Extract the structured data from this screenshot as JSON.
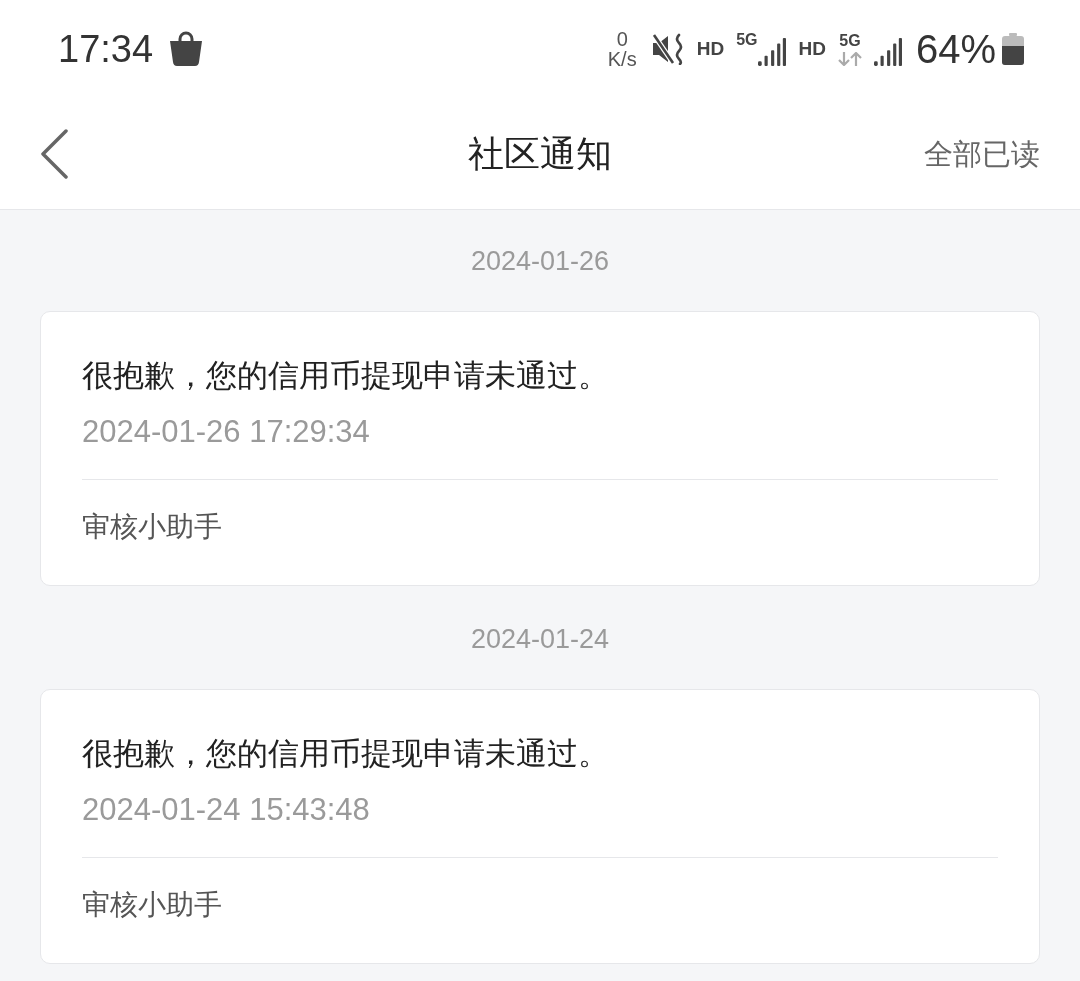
{
  "status_bar": {
    "time": "17:34",
    "indicators": [
      {
        "kind": "speed",
        "value": "0",
        "unit": "K/s"
      },
      {
        "kind": "mute"
      },
      {
        "kind": "hd",
        "label": "HD"
      },
      {
        "kind": "signal",
        "label": "5G"
      },
      {
        "kind": "hd",
        "label": "HD"
      },
      {
        "kind": "data",
        "label": "5G"
      },
      {
        "kind": "signal"
      }
    ],
    "battery": "64%"
  },
  "header": {
    "title": "社区通知",
    "action": "全部已读"
  },
  "sections": [
    {
      "date": "2024-01-26",
      "notices": [
        {
          "message": "很抱歉，您的信用币提现申请未通过。",
          "time": "2024-01-26 17:29:34",
          "sender": "审核小助手"
        }
      ]
    },
    {
      "date": "2024-01-24",
      "notices": [
        {
          "message": "很抱歉，您的信用币提现申请未通过。",
          "time": "2024-01-24 15:43:48",
          "sender": "审核小助手"
        }
      ]
    }
  ]
}
